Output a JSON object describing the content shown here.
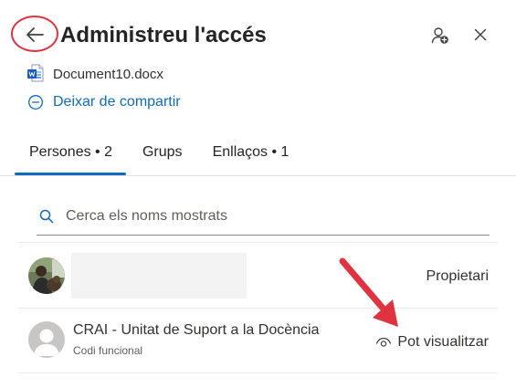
{
  "header": {
    "title": "Administreu l'accés",
    "back_icon": "arrow-left-icon",
    "add_person_icon": "person-add-icon",
    "close_icon": "close-icon"
  },
  "document": {
    "name": "Document10.docx",
    "icon": "word-document-icon",
    "stop_sharing_label": "Deixar de compartir"
  },
  "tabs": [
    {
      "label": "Persones • 2",
      "active": true
    },
    {
      "label": "Grups",
      "active": false
    },
    {
      "label": "Enllaços • 1",
      "active": false
    }
  ],
  "search": {
    "placeholder": "Cerca els noms mostrats",
    "value": ""
  },
  "members": [
    {
      "name": "",
      "role": "Propietari",
      "avatar": "photo-avatar"
    },
    {
      "name": "CRAI - Unitat de Suport a la Docència",
      "subtitle": "Codi funcional",
      "role": "Pot visualitzar",
      "avatar": "generic-avatar",
      "role_icon": "eye-icon"
    }
  ],
  "colors": {
    "accent": "#0f6cbd",
    "highlight": "#e0333f"
  }
}
